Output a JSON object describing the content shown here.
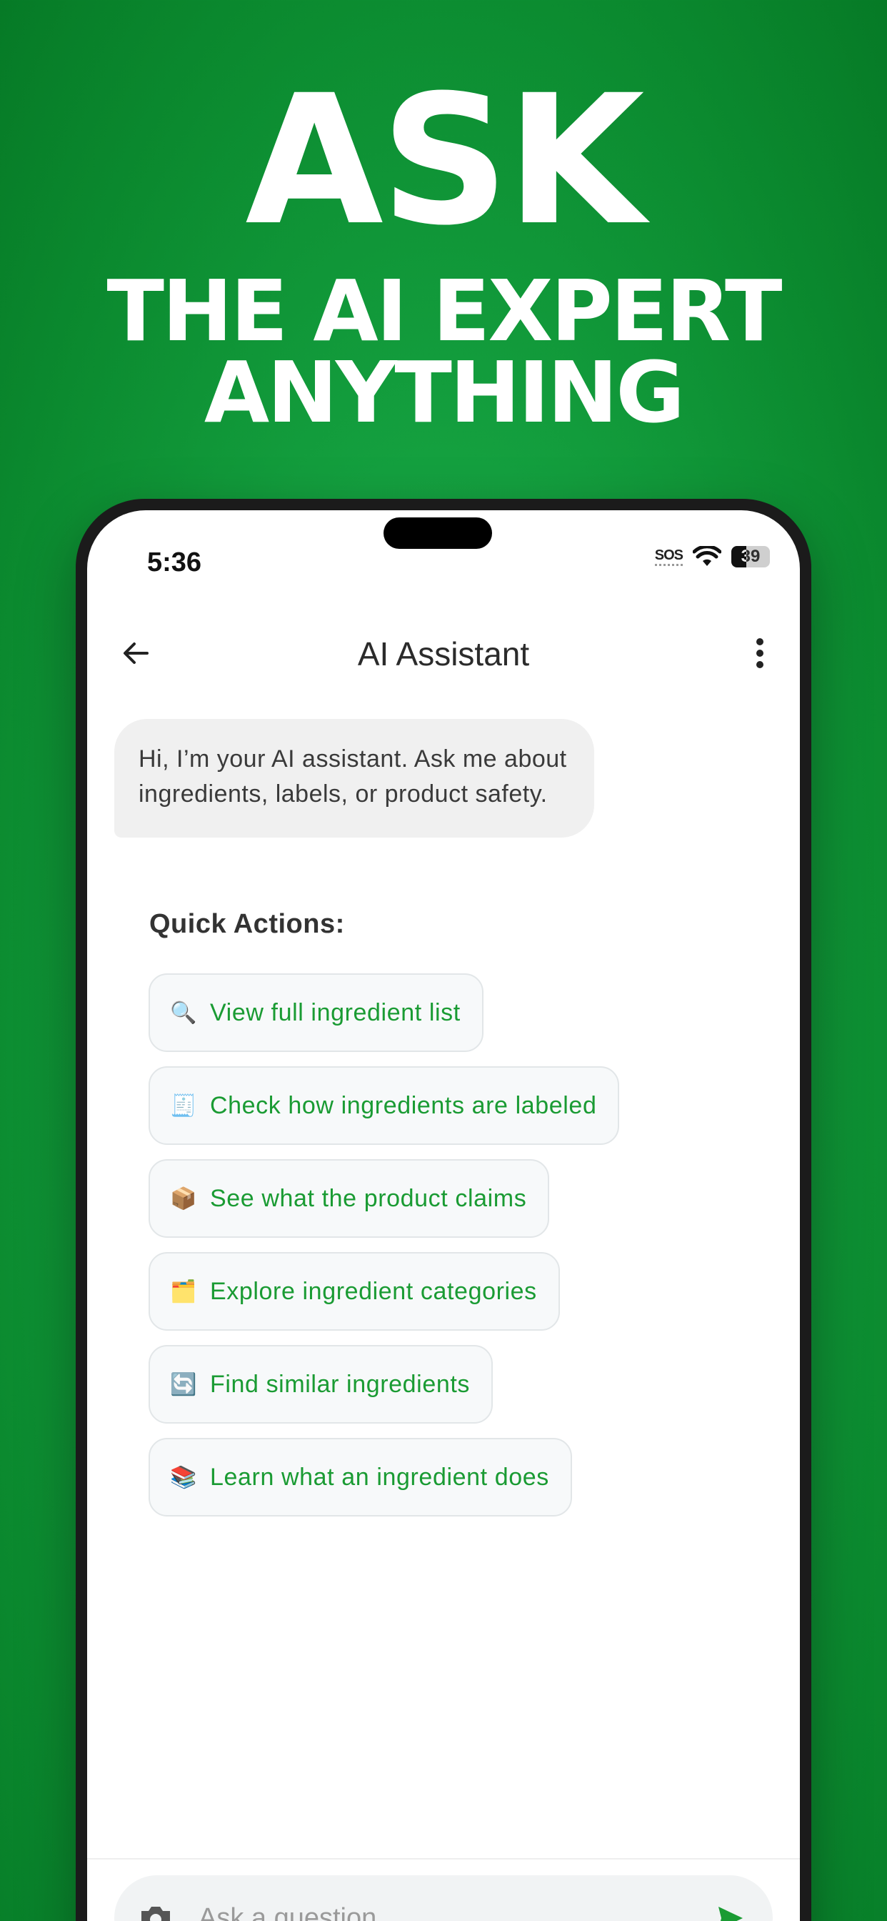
{
  "promo": {
    "headline": "ASK",
    "subheadline_line1": "THE AI EXPERT",
    "subheadline_line2": "ANYTHING"
  },
  "status_bar": {
    "time": "5:36",
    "sos": "SOS",
    "battery": "39",
    "battery_level": 0.39
  },
  "header": {
    "title": "AI Assistant",
    "back_icon": "arrow-left-icon",
    "menu_icon": "more-vertical-icon"
  },
  "chat": {
    "assistant_message": "Hi, I’m your AI assistant. Ask me about ingredients, labels, or product safety."
  },
  "quick_actions": {
    "title": "Quick Actions:",
    "items": [
      {
        "emoji": "🔍",
        "label": "View full ingredient list"
      },
      {
        "emoji": "🧾",
        "label": "Check how ingredients are labeled"
      },
      {
        "emoji": "📦",
        "label": "See what the product claims"
      },
      {
        "emoji": "🗂️",
        "label": "Explore ingredient categories"
      },
      {
        "emoji": "🔄",
        "label": "Find similar ingredients"
      },
      {
        "emoji": "📚",
        "label": "Learn what an ingredient does"
      }
    ]
  },
  "input": {
    "placeholder": "Ask a question...",
    "value": "",
    "camera_icon": "camera-icon",
    "send_icon": "send-icon"
  },
  "colors": {
    "accent": "#1a9b33",
    "background_green": "#14a03f"
  }
}
